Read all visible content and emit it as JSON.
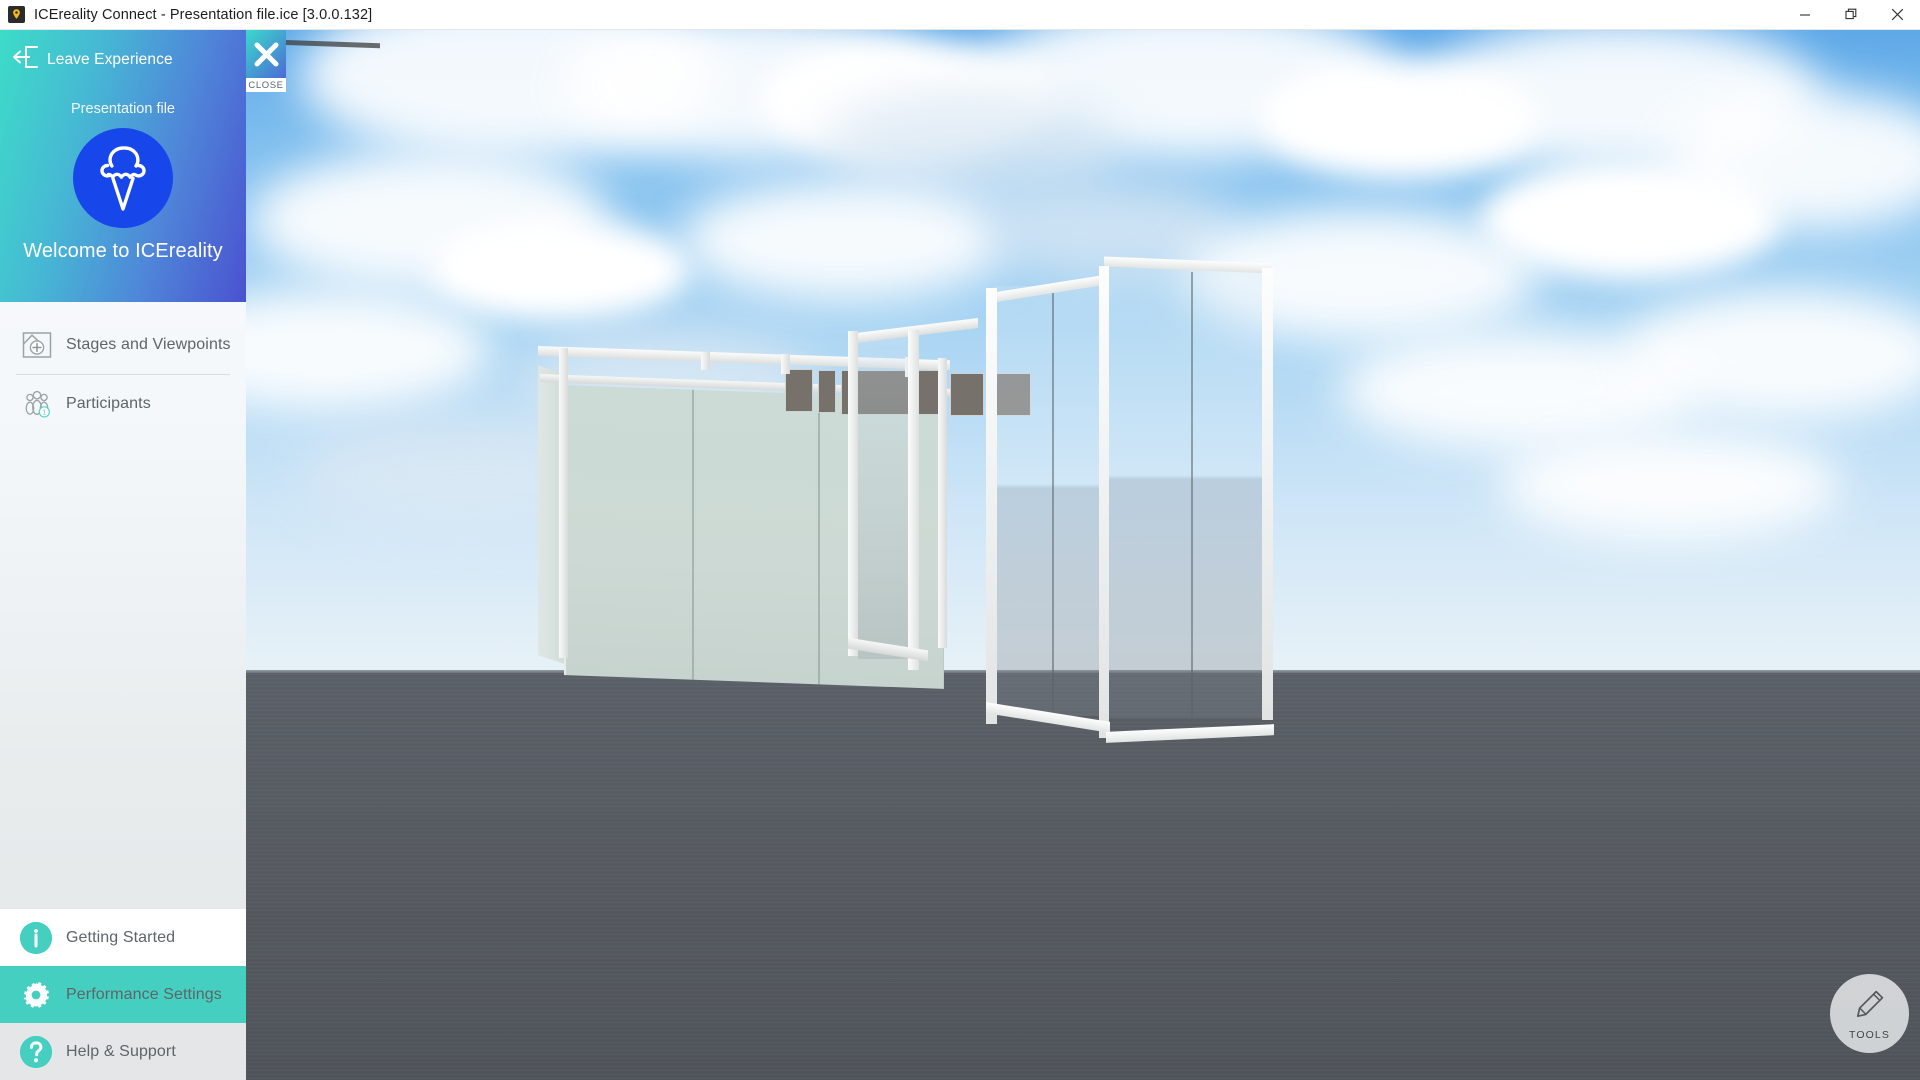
{
  "titlebar": {
    "title": "ICEreality Connect - Presentation file.ice [3.0.0.132]",
    "app_icon": "location-pin-icon",
    "minimize_label": "—",
    "restore_label": "restore-icon",
    "close_label": "✕"
  },
  "close_button": {
    "glyph": "✕",
    "label": "CLOSE",
    "icon": "close-icon"
  },
  "sidebar": {
    "leave": {
      "label": "Leave Experience",
      "icon": "exit-arrow-icon"
    },
    "presentation_file": "Presentation file",
    "logo_icon": "ice-cream-cone-icon",
    "welcome": "Welcome to ICEreality",
    "menu": [
      {
        "label": "Stages and Viewpoints",
        "icon": "stage-add-icon"
      },
      {
        "label": "Participants",
        "icon": "people-group-icon",
        "badge": "1"
      }
    ],
    "bottom": [
      {
        "label": "Getting Started",
        "icon": "info-icon",
        "state": "normal"
      },
      {
        "label": "Performance Settings",
        "icon": "gear-icon",
        "state": "selected"
      },
      {
        "label": "Help & Support",
        "icon": "question-icon",
        "state": "normal"
      }
    ]
  },
  "tools": {
    "label": "TOOLS",
    "icon": "pencil-icon"
  },
  "colors": {
    "accent_teal": "#45cfc0",
    "accent_blue": "#4a52d0",
    "logo_blue": "#1746ea",
    "sidebar_bg": "#e4e6e7",
    "ground": "#55595f",
    "sky_top": "#5fa9e8"
  }
}
